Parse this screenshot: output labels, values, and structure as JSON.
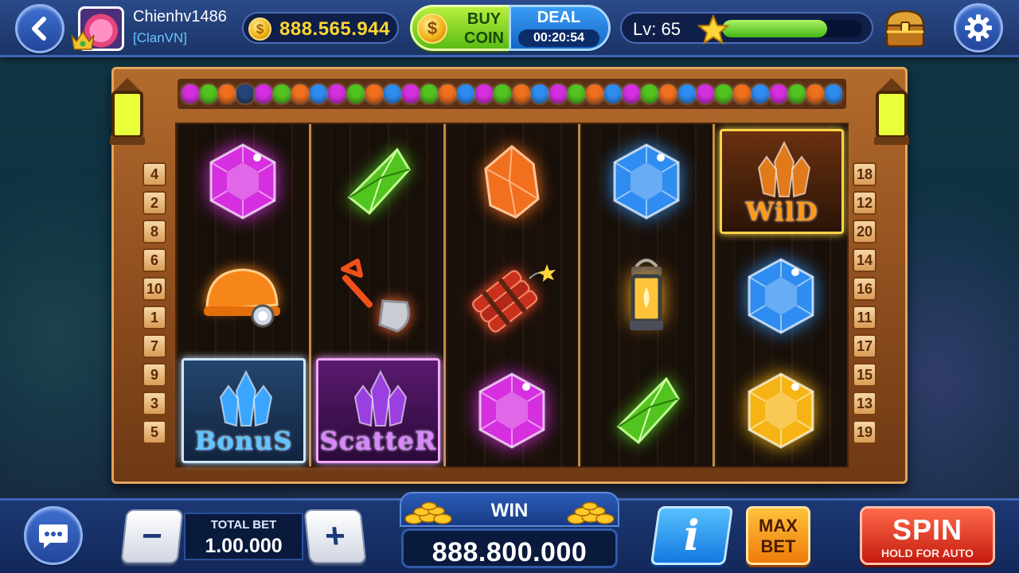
{
  "player": {
    "username": "Chienhv1486",
    "clan": "[ClanVN]"
  },
  "balance": {
    "coins": "888.565.944"
  },
  "shop": {
    "buy_line1": "BUY",
    "buy_line2": "COIN",
    "deal_label": "DEAL",
    "deal_timer": "00:20:54"
  },
  "level": {
    "text": "Lv: 65",
    "xp_fraction": 0.75
  },
  "paylines": {
    "left": [
      "4",
      "2",
      "8",
      "6",
      "10",
      "1",
      "7",
      "9",
      "3",
      "5"
    ],
    "right": [
      "18",
      "12",
      "20",
      "14",
      "16",
      "11",
      "17",
      "15",
      "13",
      "19"
    ]
  },
  "reels": [
    [
      "purple-gem",
      "miner-helmet",
      "bonus"
    ],
    [
      "green-gem",
      "shovel",
      "scatter"
    ],
    [
      "orange-gem",
      "dynamite",
      "purple-gem"
    ],
    [
      "blue-gem",
      "lantern",
      "green-gem"
    ],
    [
      "wild",
      "blue-gem",
      "yellow-gem"
    ]
  ],
  "special_labels": {
    "bonus": "BonuS",
    "scatter": "ScatteR",
    "wild": "WilD"
  },
  "gem_strip": [
    "purple",
    "green",
    "orange",
    "navy",
    "purple",
    "green",
    "orange",
    "blue",
    "purple",
    "green",
    "orange",
    "blue",
    "purple",
    "green",
    "orange",
    "blue",
    "purple",
    "green",
    "orange",
    "blue",
    "purple",
    "green",
    "orange",
    "blue",
    "purple",
    "green",
    "orange",
    "blue",
    "purple",
    "green",
    "orange",
    "blue",
    "purple",
    "green",
    "orange",
    "blue"
  ],
  "bet": {
    "label": "TOTAL BET",
    "value": "1.00.000",
    "minus": "−",
    "plus": "+"
  },
  "win": {
    "label": "WIN",
    "value": "888.800.000"
  },
  "controls": {
    "info": "i",
    "maxbet_line1": "MAX",
    "maxbet_line2": "BET",
    "spin": "SPIN",
    "spin_sub": "HOLD FOR AUTO"
  },
  "colors": {
    "purple": "#d52fe0",
    "green": "#52c41f",
    "orange": "#f0701e",
    "navy": "#26467a",
    "blue": "#2f8cf0",
    "yellow": "#f6b414",
    "accent_gold": "#ffd631",
    "clan": "#66c8ff"
  },
  "icons": [
    "back-arrow-icon",
    "avatar",
    "coin-icon",
    "star-icon",
    "treasure-chest-icon",
    "gear-icon",
    "chat-icon",
    "lantern-icon"
  ]
}
